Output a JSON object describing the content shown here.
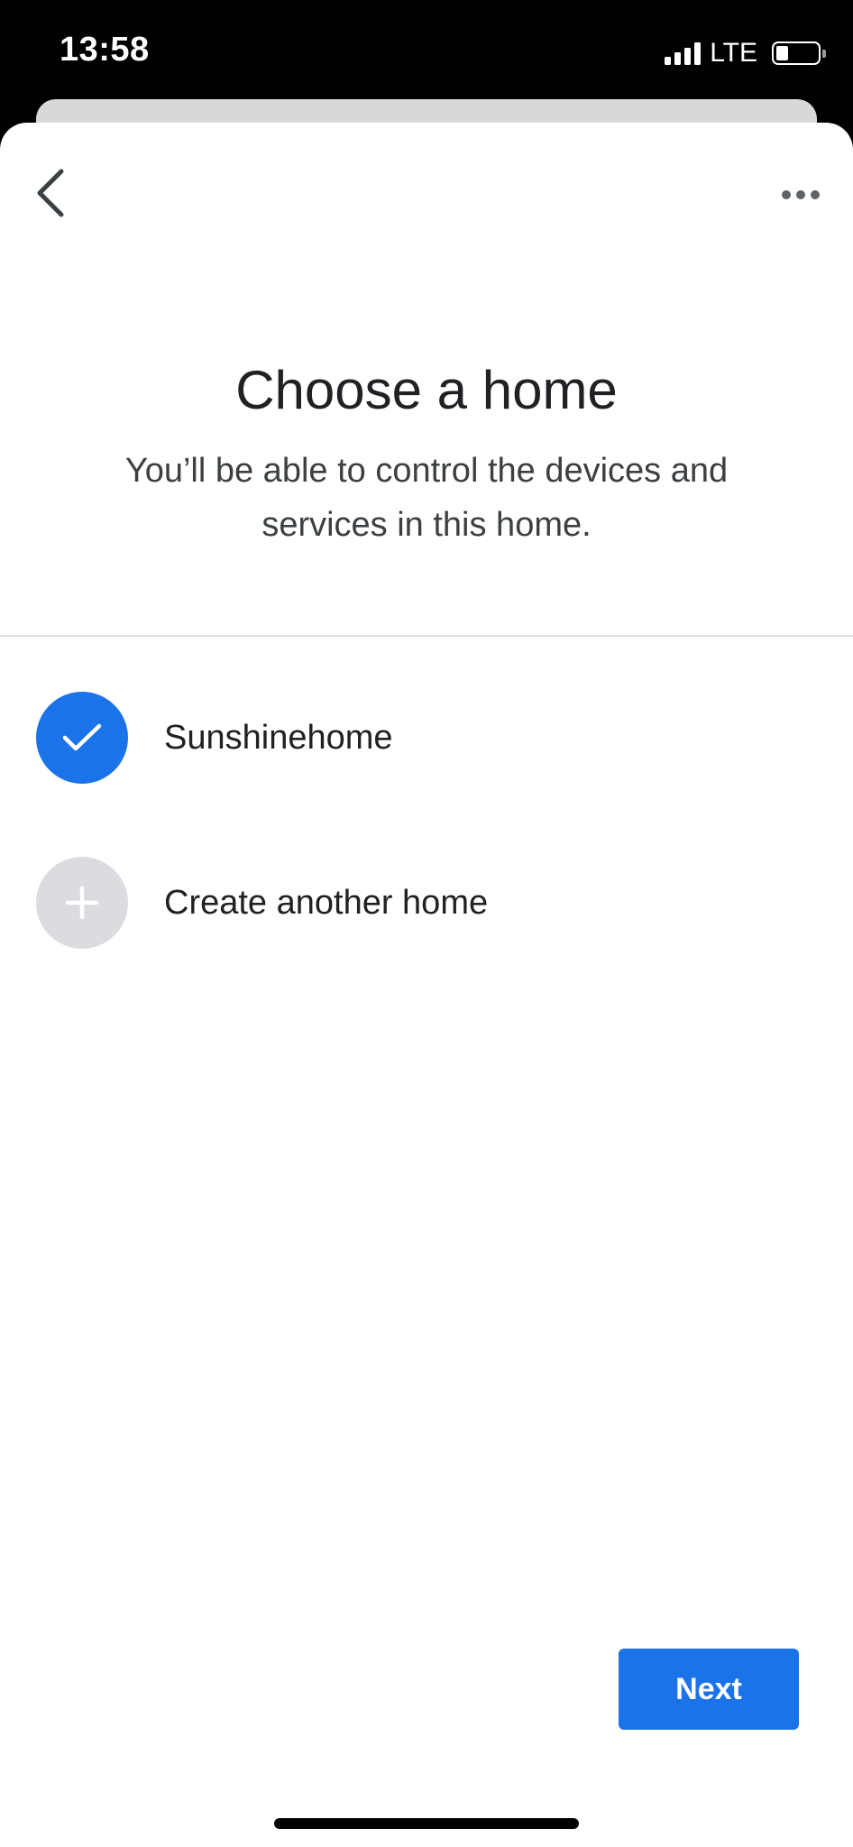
{
  "status_bar": {
    "time": "13:58",
    "network": "LTE",
    "battery_level": 0.15,
    "signal_bars": 4
  },
  "header": {
    "back_icon": "chevron-left-icon",
    "more_icon": "more-horizontal-icon"
  },
  "main": {
    "title": "Choose a home",
    "subtitle": "You’ll be able to control the devices and services in this home."
  },
  "options": [
    {
      "label": "Sunshinehome",
      "icon": "check-icon",
      "selected": true
    },
    {
      "label": "Create another home",
      "icon": "plus-icon",
      "selected": false
    }
  ],
  "footer": {
    "next_label": "Next"
  },
  "colors": {
    "accent": "#1a73e8",
    "text_primary": "#202124",
    "divider": "#dadce0",
    "add_circle": "#dadce0"
  }
}
